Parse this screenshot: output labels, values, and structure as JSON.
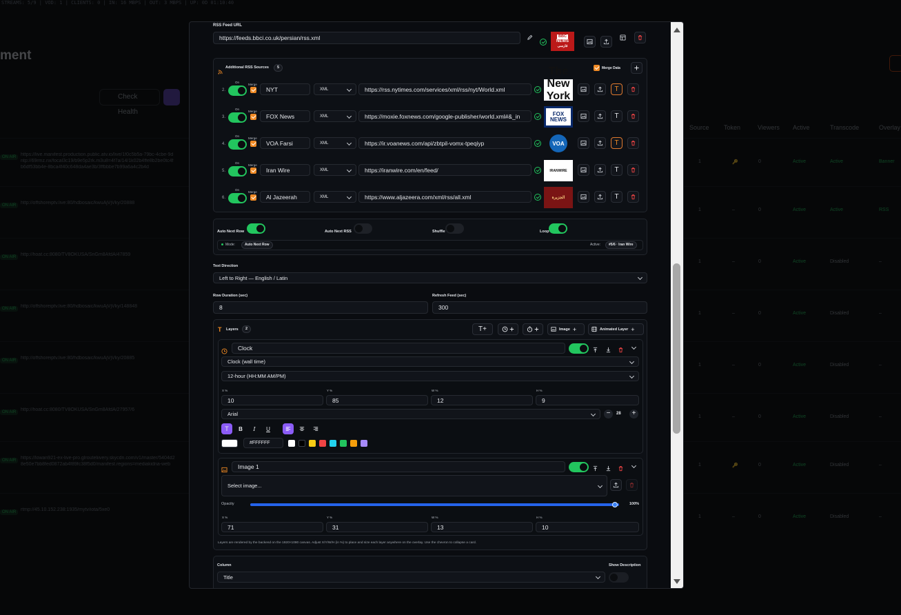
{
  "background": {
    "status_bar": "STREAMS: 5/9  |  VOD: 1  |  CLIENTS: 0  |  IN: 16 MBPS  |  OUT: 3 MBPS  |  UP: 0D 01:10:40",
    "page_title": "ment",
    "check_health": "Check Health",
    "columns": [
      "Source",
      "Token",
      "Viewers",
      "Active",
      "Transcode",
      "Overlay"
    ],
    "rows": [
      {
        "badge": "ON AIR",
        "url": "https://live.manifest.production.public.atv.io/live/1f0c5b5a-79bc-4cbe-9d",
        "url2": "ntp://69rmz.nx/focal3c19/b9e5p2rk.m3u8=4f7a/14/1k02b4ffe8b2be0tc4f",
        "url3": "b6df53bb4e-8bca4f40c648da4ae3b/3ffbbbe7b99a6a4c2b4d",
        "source": "1",
        "token": "🔑",
        "viewers": "0",
        "active": "Active",
        "transcode": "Active",
        "overlay": "Banner"
      },
      {
        "badge": "ON AIR",
        "url": "http://offshoreiptv.live:80/hdbosaic/kwuAjVjVky/20888",
        "source": "1",
        "token": "–",
        "viewers": "0",
        "active": "Active",
        "transcode": "Active",
        "overlay": "RSS"
      },
      {
        "badge": "ON AIR",
        "url": "http://hoat.cc:8080/TV8OKUSA/SnGm8AfdA/47859",
        "source": "1",
        "token": "–",
        "viewers": "0",
        "active": "Active",
        "transcode": "Disabled",
        "overlay": "–"
      },
      {
        "badge": "ON AIR",
        "url": "http://offshoreiptv.live:80/hdbosaic/kwuAjVjVky/148848",
        "source": "1",
        "token": "–",
        "viewers": "0",
        "active": "Active",
        "transcode": "Disabled",
        "overlay": "–"
      },
      {
        "badge": "ON AIR",
        "url": "http://offshoreiptv.live:80/hdbosaic/kwuAjVjVky/20885",
        "source": "1",
        "token": "–",
        "viewers": "0",
        "active": "Active",
        "transcode": "Disabled",
        "overlay": "–"
      },
      {
        "badge": "ON AIR",
        "url": "http://hoat.cc:8080/TV8OKUSA/SnGm8AfdA/27957/6",
        "source": "1",
        "token": "–",
        "viewers": "0",
        "active": "Active",
        "transcode": "Disabled",
        "overlay": "–"
      },
      {
        "badge": "ON AIR",
        "url": "https://lowan921-ex-live-pro.glrouteliivery.skycdn.com/v1/master/5404d2",
        "url2": "8e50e7bb8fed0872ab4f89fc38f5d0/manifest.regions=mediakidna-web",
        "source": "1",
        "token": "🔑",
        "viewers": "0",
        "active": "Active",
        "transcode": "Disabled",
        "overlay": "–"
      },
      {
        "badge": "ON AIR",
        "url": "rtmp://45.10.152.238:1935/mytv/iota/5xe0",
        "source": "1",
        "token": "–",
        "viewers": "0",
        "active": "Active",
        "transcode": "Disabled",
        "overlay": "–"
      }
    ]
  },
  "rss": {
    "feed_url_label": "RSS Feed URL",
    "feed_url": "https://feeds.bbci.co.uk/persian/rss.xml",
    "bbc_logo": {
      "line1": "BBC",
      "line2": "NEWS",
      "line3": "فارسی"
    },
    "additional_label": "Additional RSS Sources",
    "additional_count": "5",
    "merge_data_label": "Merge Data",
    "sources": [
      {
        "index": "2.",
        "on": "On",
        "merge": "Merge",
        "name": "NYT",
        "format": "XML",
        "url": "https://rss.nytimes.com/services/xml/rss/nyt/World.xml",
        "logo": "The New York Times",
        "t_active": true
      },
      {
        "index": "3.",
        "on": "On",
        "merge": "Merge",
        "name": "FOX News",
        "format": "XML",
        "url": "https://moxie.foxnews.com/google-publisher/world.xml#&_in",
        "logo": "FOX NEWS",
        "t_active": false
      },
      {
        "index": "4.",
        "on": "On",
        "merge": "Merge",
        "name": "VOA Farsi",
        "format": "XML",
        "url": "https://ir.voanews.com/api/zbtpil-vomx-tpeqiyp",
        "logo": "VOA",
        "t_active": true
      },
      {
        "index": "5.",
        "on": "On",
        "merge": "Merge",
        "name": "Iran Wire",
        "format": "XML",
        "url": "https://iranwire.com/en/feed/",
        "logo": "IRANWIRE",
        "t_active": false
      },
      {
        "index": "6.",
        "on": "On",
        "merge": "Merge",
        "name": "Al Jazeerah",
        "format": "XML",
        "url": "https://www.aljazeera.com/xml/rss/all.xml",
        "logo": "الجزيرة",
        "t_active": false
      }
    ]
  },
  "playback": {
    "auto_next_row": "Auto Next Row",
    "auto_next_rss": "Auto Next RSS",
    "shuffle": "Shuffle",
    "loop": "Loop",
    "mode_label": "Mode:",
    "mode_value": "Auto Next Row",
    "active_label": "Active:",
    "active_value": "#5/6 · Iran Wire"
  },
  "text_direction": {
    "label": "Text Direction",
    "value": "Left to Right — English / Latin"
  },
  "row_duration": {
    "label": "Row Duration (sec)",
    "value": "8"
  },
  "refresh_feed": {
    "label": "Refresh Feed (sec)",
    "value": "300"
  },
  "layers": {
    "label": "Layers",
    "count": "2",
    "image_btn": "Image",
    "animated_btn": "Animated Layer",
    "clock": {
      "name": "Clock",
      "type": "Clock (wall time)",
      "format": "12-hour (HH:MM AM/PM)",
      "x_label": "X %",
      "y_label": "Y %",
      "w_label": "W %",
      "h_label": "H %",
      "x": "10",
      "y": "85",
      "w": "12",
      "h": "9",
      "font": "Arial",
      "font_size": "28",
      "color_hex": "#FFFFFF",
      "swatches": [
        "#ffffff",
        "#000000",
        "#facc15",
        "#ef4444",
        "#22d3ee",
        "#22c55e",
        "#f59e0b",
        "#a78bfa"
      ]
    },
    "image": {
      "name": "Image 1",
      "select": "Select image...",
      "opacity_label": "Opacity",
      "opacity_value": "100%",
      "opacity_fraction": 1.0,
      "x_label": "X %",
      "y_label": "Y %",
      "w_label": "W %",
      "h_label": "H %",
      "x": "71",
      "y": "31",
      "w": "13",
      "h": "10"
    },
    "note": "Layers are rendered by the backend on the 1920×1080 canvas. Adjust X/Y/W/H (in %) to place and size each layer anywhere on the overlay. Use the chevron to collapse a card."
  },
  "column": {
    "label": "Column",
    "value": "Title",
    "show_description": "Show Description"
  },
  "colors": {
    "accent_green": "#22c55e",
    "accent_orange": "#f08a24",
    "accent_purple": "#8b5cf6",
    "danger": "#ef4444"
  }
}
